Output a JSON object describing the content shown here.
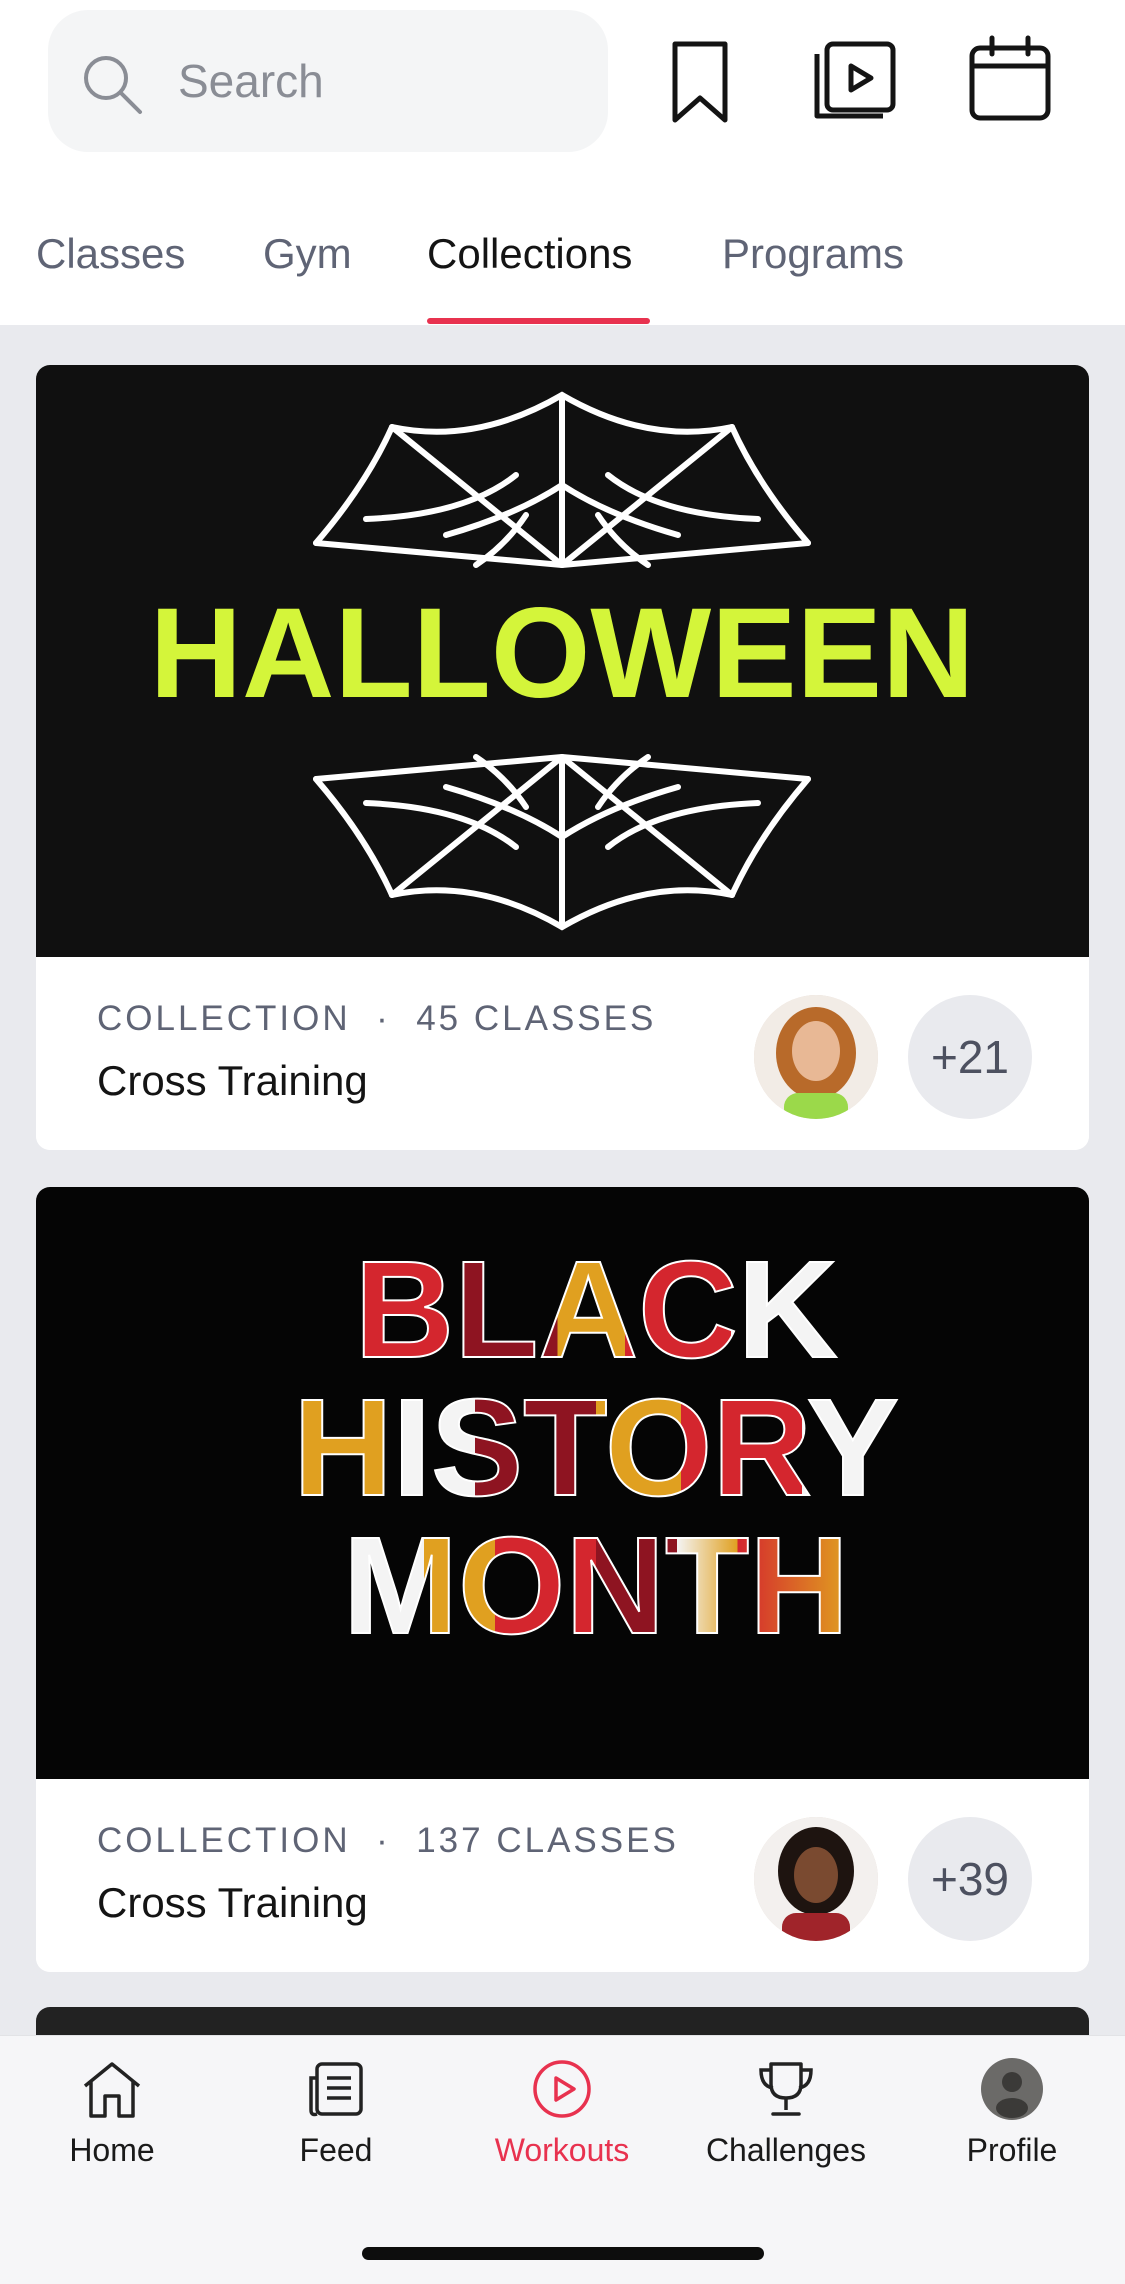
{
  "search": {
    "placeholder": "Search"
  },
  "header_icons": [
    "bookmark-icon",
    "video-library-icon",
    "calendar-icon"
  ],
  "tabs": [
    {
      "label": "Classes",
      "active": false
    },
    {
      "label": "Gym",
      "active": false
    },
    {
      "label": "Collections",
      "active": true
    },
    {
      "label": "Programs",
      "active": false
    }
  ],
  "cards": [
    {
      "banner_text": "HALLOWEEN",
      "banner_color": "#d4f53a",
      "eyebrow": "COLLECTION  ·  45 CLASSES",
      "title": "Cross Training",
      "more_count": "+21"
    },
    {
      "banner_lines": [
        "BLACK",
        "HISTORY",
        "MONTH"
      ],
      "banner_colors": [
        "#d4262e",
        "#e0a020",
        "#8e1421",
        "#f0f0f0"
      ],
      "eyebrow": "COLLECTION  ·  137 CLASSES",
      "title": "Cross Training",
      "more_count": "+39"
    }
  ],
  "nav": [
    {
      "label": "Home",
      "icon": "home-icon",
      "active": false
    },
    {
      "label": "Feed",
      "icon": "feed-icon",
      "active": false
    },
    {
      "label": "Workouts",
      "icon": "play-circle-icon",
      "active": true
    },
    {
      "label": "Challenges",
      "icon": "trophy-icon",
      "active": false
    },
    {
      "label": "Profile",
      "icon": "profile-avatar",
      "active": false
    }
  ],
  "colors": {
    "accent": "#e8324f",
    "background": "#e9eaee"
  }
}
